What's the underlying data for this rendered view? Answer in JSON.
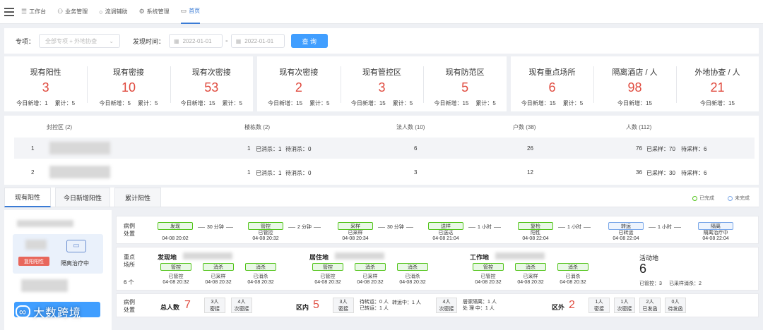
{
  "nav": {
    "items": [
      {
        "label": "工作台",
        "icon": "list-icon"
      },
      {
        "label": "业务管理",
        "icon": "org-icon"
      },
      {
        "label": "流调辅助",
        "icon": "circle-icon"
      },
      {
        "label": "系统管理",
        "icon": "gear-icon"
      },
      {
        "label": "首页",
        "icon": "monitor-icon"
      }
    ],
    "active": 4
  },
  "filter": {
    "topic_label": "专项：",
    "topic_placeholder": "全部专项 + 外地协查",
    "date_label": "发现时间：",
    "date_start": "2022-01-01",
    "date_sep": "-",
    "date_end": "2022-01-01",
    "query_button": "查 询"
  },
  "stats": [
    {
      "title": "现有阳性",
      "value": "3",
      "today": "今日新增：1",
      "total": "累计：5"
    },
    {
      "title": "现有密接",
      "value": "10",
      "today": "今日新增：5",
      "total": "累计：5"
    },
    {
      "title": "现有次密接",
      "value": "53",
      "today": "今日新增：15",
      "total": "累计：5"
    },
    {
      "title": "现有次密接",
      "value": "2",
      "today": "今日新增：15",
      "total": "累计：5"
    },
    {
      "title": "现有管控区",
      "value": "3",
      "today": "今日新增：15",
      "total": "累计：5"
    },
    {
      "title": "现有防范区",
      "value": "5",
      "today": "今日新增：15",
      "total": "累计：5"
    },
    {
      "title": "现有重点场所",
      "value": "6",
      "today": "今日新增：15",
      "total": "累计：5"
    },
    {
      "title": "隔离酒店 / 人",
      "value": "98",
      "today": "今日新增：15",
      "total": ""
    },
    {
      "title": "外地协查 / 人",
      "value": "21",
      "today": "今日新增：15",
      "total": ""
    }
  ],
  "area_table": {
    "headers": [
      "封控区 (2)",
      "楼栋数 (2)",
      "法人数 (10)",
      "户数 (38)",
      "人数 (112)"
    ],
    "rows": [
      {
        "idx": "1",
        "buildings": "1",
        "disinfected": "已消杀：1",
        "pending": "待消杀：0",
        "legal": "6",
        "households": "26",
        "people": "76",
        "sampled": "已采样：70",
        "to_sample": "待采样：6"
      },
      {
        "idx": "2",
        "buildings": "1",
        "disinfected": "已消杀：1",
        "pending": "待消杀：0",
        "legal": "3",
        "households": "12",
        "people": "36",
        "sampled": "已采样：30",
        "to_sample": "待采样：6"
      }
    ]
  },
  "tabs": [
    "现有阳性",
    "今日新增阳性",
    "累计阳性"
  ],
  "legend": {
    "done": "已完成",
    "todo": "未完成",
    "done_color": "#52c41a",
    "todo_color": "#7aa7e8"
  },
  "patient": {
    "badge": "复阳阳性",
    "status": "隔离治疗中"
  },
  "flow": {
    "label_line1": "病例",
    "label_line2": "处置",
    "steps": [
      {
        "name": "发现",
        "sub": "",
        "time": "04-08 20:02",
        "state": "done"
      },
      {
        "name": "管控",
        "sub": "已管控",
        "time": "04-08 20:32",
        "state": "done"
      },
      {
        "name": "采样",
        "sub": "已采样",
        "time": "04-08 20:34",
        "state": "done"
      },
      {
        "name": "送样",
        "sub": "已送达",
        "time": "04-08 21:04",
        "state": "done"
      },
      {
        "name": "复检",
        "sub": "阳性",
        "time": "04-08 22:04",
        "state": "done"
      },
      {
        "name": "转运",
        "sub": "已转运",
        "time": "04-08 22:04",
        "state": "todo"
      },
      {
        "name": "隔离",
        "sub": "隔离治疗中",
        "time": "04-08 22:04",
        "state": "todo"
      }
    ],
    "gaps": [
      "30 分钟",
      "2 分钟",
      "30 分钟",
      "1 小时",
      "1 小时",
      "1 小时"
    ]
  },
  "places": {
    "label_line1": "重点",
    "label_line2": "场所",
    "count": "6 个",
    "groups": [
      {
        "title": "发现地",
        "tags": [
          "管控",
          "消杀",
          "消杀"
        ],
        "subs": [
          "已管控",
          "已采样",
          "已消杀"
        ],
        "time": "04-08 20:32"
      },
      {
        "title": "居住地",
        "tags": [
          "管控",
          "消杀",
          "消杀"
        ],
        "subs": [
          "已管控",
          "已采样",
          "已消杀"
        ],
        "time": "04-08 20:32"
      },
      {
        "title": "工作地",
        "tags": [
          "管控",
          "消杀",
          "消杀"
        ],
        "subs": [
          "已管控",
          "已采样",
          "已消杀"
        ],
        "time": "04-08 20:32"
      }
    ],
    "activity": {
      "title": "活动地",
      "value": "6",
      "sampled": "已管控：3",
      "disinfect": "已采样消杀：2"
    }
  },
  "cases": {
    "label_line1": "病例",
    "label_line2": "处置",
    "total_label": "总人数",
    "total_value": "7",
    "total_cells": [
      {
        "n": "3人",
        "t": "密接"
      },
      {
        "n": "4人",
        "t": "次密接"
      }
    ],
    "in_label": "区内",
    "in_value": "5",
    "in_cells": [
      {
        "n": "3人",
        "t": "密接"
      }
    ],
    "in_text1": "待转运：0 人",
    "in_text2": "已转运：1 人",
    "in_text3": "转运中：1 人",
    "in_cells2": [
      {
        "n": "4人",
        "t": "次密接"
      }
    ],
    "in_text4": "居家隔离：1 人",
    "in_text5": "处 理 中：1 人",
    "out_label": "区外",
    "out_value": "2",
    "out_cells": [
      {
        "n": "1人",
        "t": "密接"
      },
      {
        "n": "1人",
        "t": "次密接"
      },
      {
        "n": "2人",
        "t": "已发函"
      },
      {
        "n": "0人",
        "t": "待发函"
      }
    ]
  },
  "watermark": "大数跨境"
}
